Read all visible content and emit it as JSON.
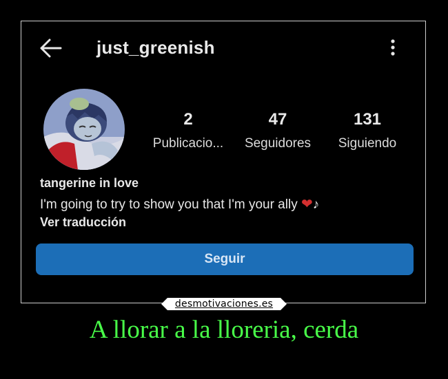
{
  "header": {
    "back_icon": "arrow-left-icon",
    "username": "just_greenish",
    "more_icon": "more-vertical-icon"
  },
  "profile": {
    "avatar": "avatar",
    "stats": [
      {
        "value": "2",
        "label": "Publicacio..."
      },
      {
        "value": "47",
        "label": "Seguidores"
      },
      {
        "value": "131",
        "label": "Siguiendo"
      }
    ]
  },
  "bio": {
    "name": "tangerine in love",
    "text": "I'm going to try to show you that I'm your ally",
    "emoji": "❤",
    "note": "♪",
    "translate_link": "Ver traducción"
  },
  "follow_button": {
    "label": "Seguir",
    "color": "#1c6eb7"
  },
  "watermark": {
    "site": "desmotivaciones.es"
  },
  "caption": {
    "text": "A llorar a la lloreria, cerda",
    "color": "#49ff49"
  }
}
